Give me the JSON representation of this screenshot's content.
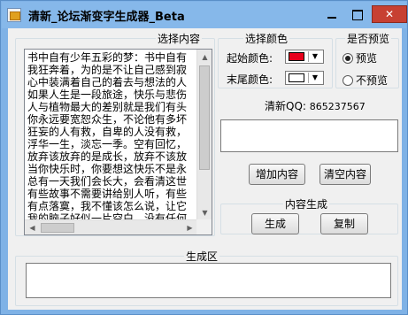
{
  "window": {
    "title": "清新_论坛渐变字生成器_Beta",
    "close_label": "✕"
  },
  "text_group": {
    "label": "选择内容",
    "text": "书中自有少年五彩的梦：书中自有中\n我狂奔着，为的是不让自己感到寂寞\n心中装满着自己的着去与想法的人，\n如果人生是一段旅途，快乐与悲伤跳\n人与植物最大的差别就是我们有头脑\n你永远要宽恕众生，不论他有多坏，\n狂妄的人有救，自卑的人没有救，认\n浮华一生，淡忘一季。空有回忆，打\n放弃该放弃的是成长，放弃不该放弃\n当你快乐时，你要想这快乐不是永恒\n总有一天我们会长大，会看清这世间\n有些故事不需要讲给别人听，有些悲\n有点落寞，我不懂该怎么说，让它在\n我的脑子好似一片空白，没有任何思\n时间流逝，颓寂未再心却已不在在这"
  },
  "color_group": {
    "label": "选择颜色",
    "start_label": "起始颜色:",
    "end_label": "末尾颜色:",
    "start_color": "#e8001c",
    "end_color": "#ffffff"
  },
  "preview_group": {
    "label": "是否预览",
    "options": [
      {
        "label": "预览",
        "checked": true
      },
      {
        "label": "不预览",
        "checked": false
      }
    ]
  },
  "qq": {
    "label": "清新QQ:",
    "number": "865237567"
  },
  "buttons": {
    "add": "增加内容",
    "clear": "清空内容",
    "generate": "生成",
    "copy": "复制"
  },
  "gen_group": {
    "label": "内容生成"
  },
  "output_group": {
    "label": "生成区"
  }
}
